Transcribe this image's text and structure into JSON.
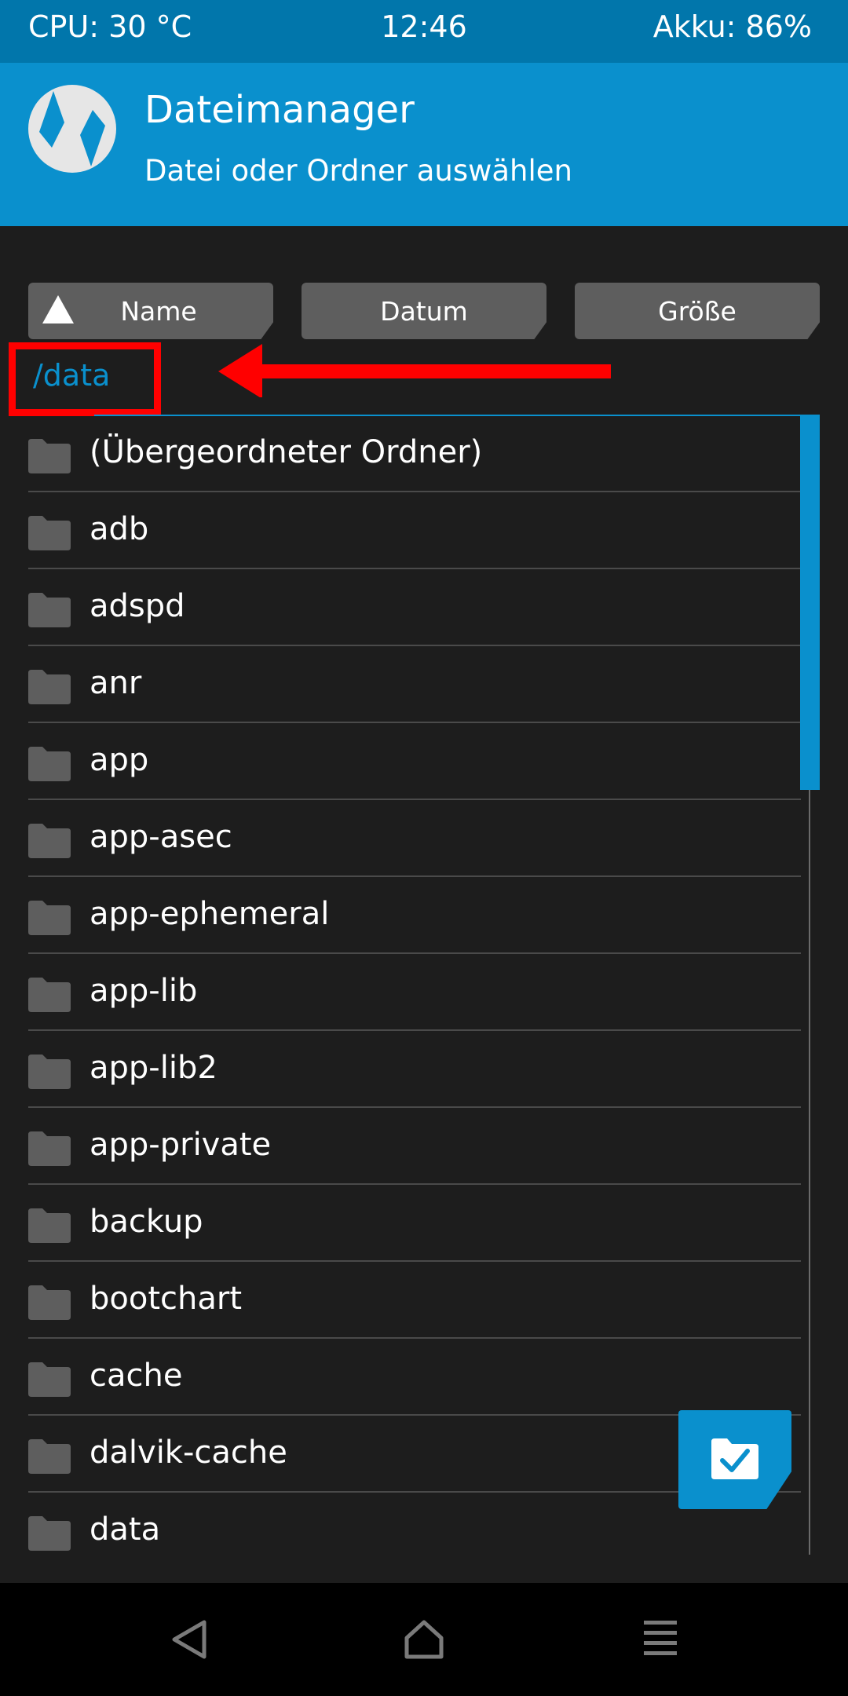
{
  "status_bar": {
    "cpu": "CPU: 30 °C",
    "time": "12:46",
    "battery": "Akku: 86%"
  },
  "header": {
    "title": "Dateimanager",
    "subtitle": "Datei oder Ordner auswählen",
    "logo_icon": "twrp-logo-icon"
  },
  "sort_buttons": {
    "name": "Name",
    "date": "Datum",
    "size": "Größe"
  },
  "current_path": "/data",
  "files": [
    "(Übergeordneter Ordner)",
    "adb",
    "adspd",
    "anr",
    "app",
    "app-asec",
    "app-ephemeral",
    "app-lib",
    "app-lib2",
    "app-private",
    "backup",
    "bootchart",
    "cache",
    "dalvik-cache",
    "data"
  ],
  "colors": {
    "accent": "#0a90cd",
    "statusbar": "#0176ab",
    "background": "#1d1d1d",
    "annotation": "#ff0000",
    "button": "#5e5e5e"
  },
  "icons": {
    "folder": "folder-icon",
    "fab": "folder-check-icon",
    "nav_back": "back-triangle-icon",
    "nav_home": "home-icon",
    "nav_menu": "menu-icon"
  }
}
